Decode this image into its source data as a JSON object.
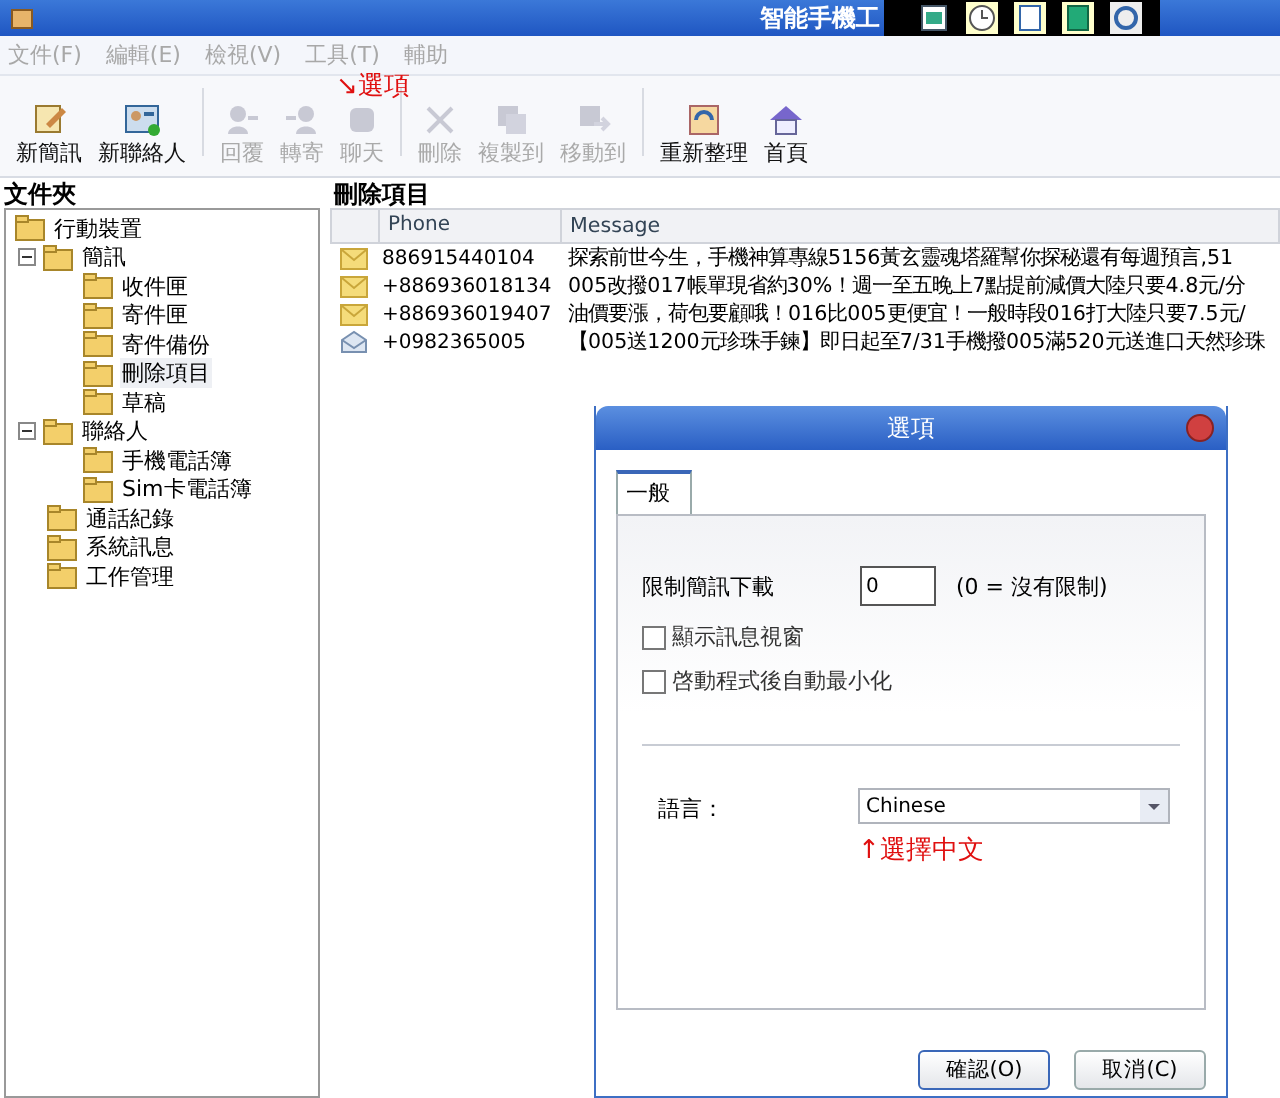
{
  "window": {
    "title": "智能手機工"
  },
  "menu": [
    {
      "label": "文件(F)"
    },
    {
      "label": "編輯(E)"
    },
    {
      "label": "檢視(V)"
    },
    {
      "label": "工具(T)"
    },
    {
      "label": "輔助"
    }
  ],
  "toolbar": [
    [
      {
        "label": "新簡訊",
        "disabled": false
      },
      {
        "label": "新聯絡人",
        "disabled": false
      }
    ],
    [
      {
        "label": "回覆",
        "disabled": true
      },
      {
        "label": "轉寄",
        "disabled": true
      },
      {
        "label": "聊天",
        "disabled": true
      }
    ],
    [
      {
        "label": "刪除",
        "disabled": true
      },
      {
        "label": "複製到",
        "disabled": true
      },
      {
        "label": "移動到",
        "disabled": true
      }
    ],
    [
      {
        "label": "重新整理",
        "disabled": false
      },
      {
        "label": "首頁",
        "disabled": false
      }
    ]
  ],
  "toolbar_annotation": "↘選項",
  "folder_panel": {
    "title": "文件夾",
    "tree": [
      {
        "label": "行動裝置",
        "selected": false,
        "children": [
          {
            "label": "簡訊",
            "expanded": true,
            "selected": false,
            "children": [
              {
                "label": "收件匣",
                "selected": false
              },
              {
                "label": "寄件匣",
                "selected": false
              },
              {
                "label": "寄件備份",
                "selected": false
              },
              {
                "label": "刪除項目",
                "selected": true
              },
              {
                "label": "草稿",
                "selected": false
              }
            ]
          },
          {
            "label": "聯絡人",
            "expanded": true,
            "selected": false,
            "children": [
              {
                "label": "手機電話簿",
                "selected": false
              },
              {
                "label": "Sim卡電話簿",
                "selected": false
              }
            ]
          },
          {
            "label": "通話紀錄",
            "selected": false
          },
          {
            "label": "系統訊息",
            "selected": false
          },
          {
            "label": "工作管理",
            "selected": false
          }
        ]
      }
    ]
  },
  "message_panel": {
    "title": "刪除項目",
    "columns": [
      "Phone",
      "Message"
    ],
    "rows": [
      {
        "read": false,
        "phone": "886915440104",
        "message": "探索前世今生，手機神算專線5156黃玄靈魂塔羅幫你探秘還有每週預言,51"
      },
      {
        "read": false,
        "phone": "+886936018134",
        "message": "005改撥017帳單現省約30%！週一至五晚上7點提前減價大陸只要4.8元/分"
      },
      {
        "read": false,
        "phone": "+886936019407",
        "message": "油價要漲，荷包要顧哦！016比005更便宜！一般時段016打大陸只要7.5元/"
      },
      {
        "read": true,
        "phone": "+0982365005",
        "message": "【005送1200元珍珠手鍊】即日起至7/31手機撥005滿520元送進口天然珍珠"
      }
    ]
  },
  "dialog": {
    "title": "選項",
    "tabs": [
      {
        "label": "一般",
        "selected": true
      }
    ],
    "limit": {
      "label": "限制簡訊下載",
      "value": "0",
      "hint": "(0 = 沒有限制)"
    },
    "checkboxes": [
      {
        "label": "顯示訊息視窗",
        "checked": false
      },
      {
        "label": "啓動程式後自動最小化",
        "checked": false
      }
    ],
    "language": {
      "label": "語言：",
      "value": "Chinese",
      "annotation": "↑選擇中文"
    },
    "buttons": [
      "確認(O)",
      "取消(C)"
    ]
  }
}
